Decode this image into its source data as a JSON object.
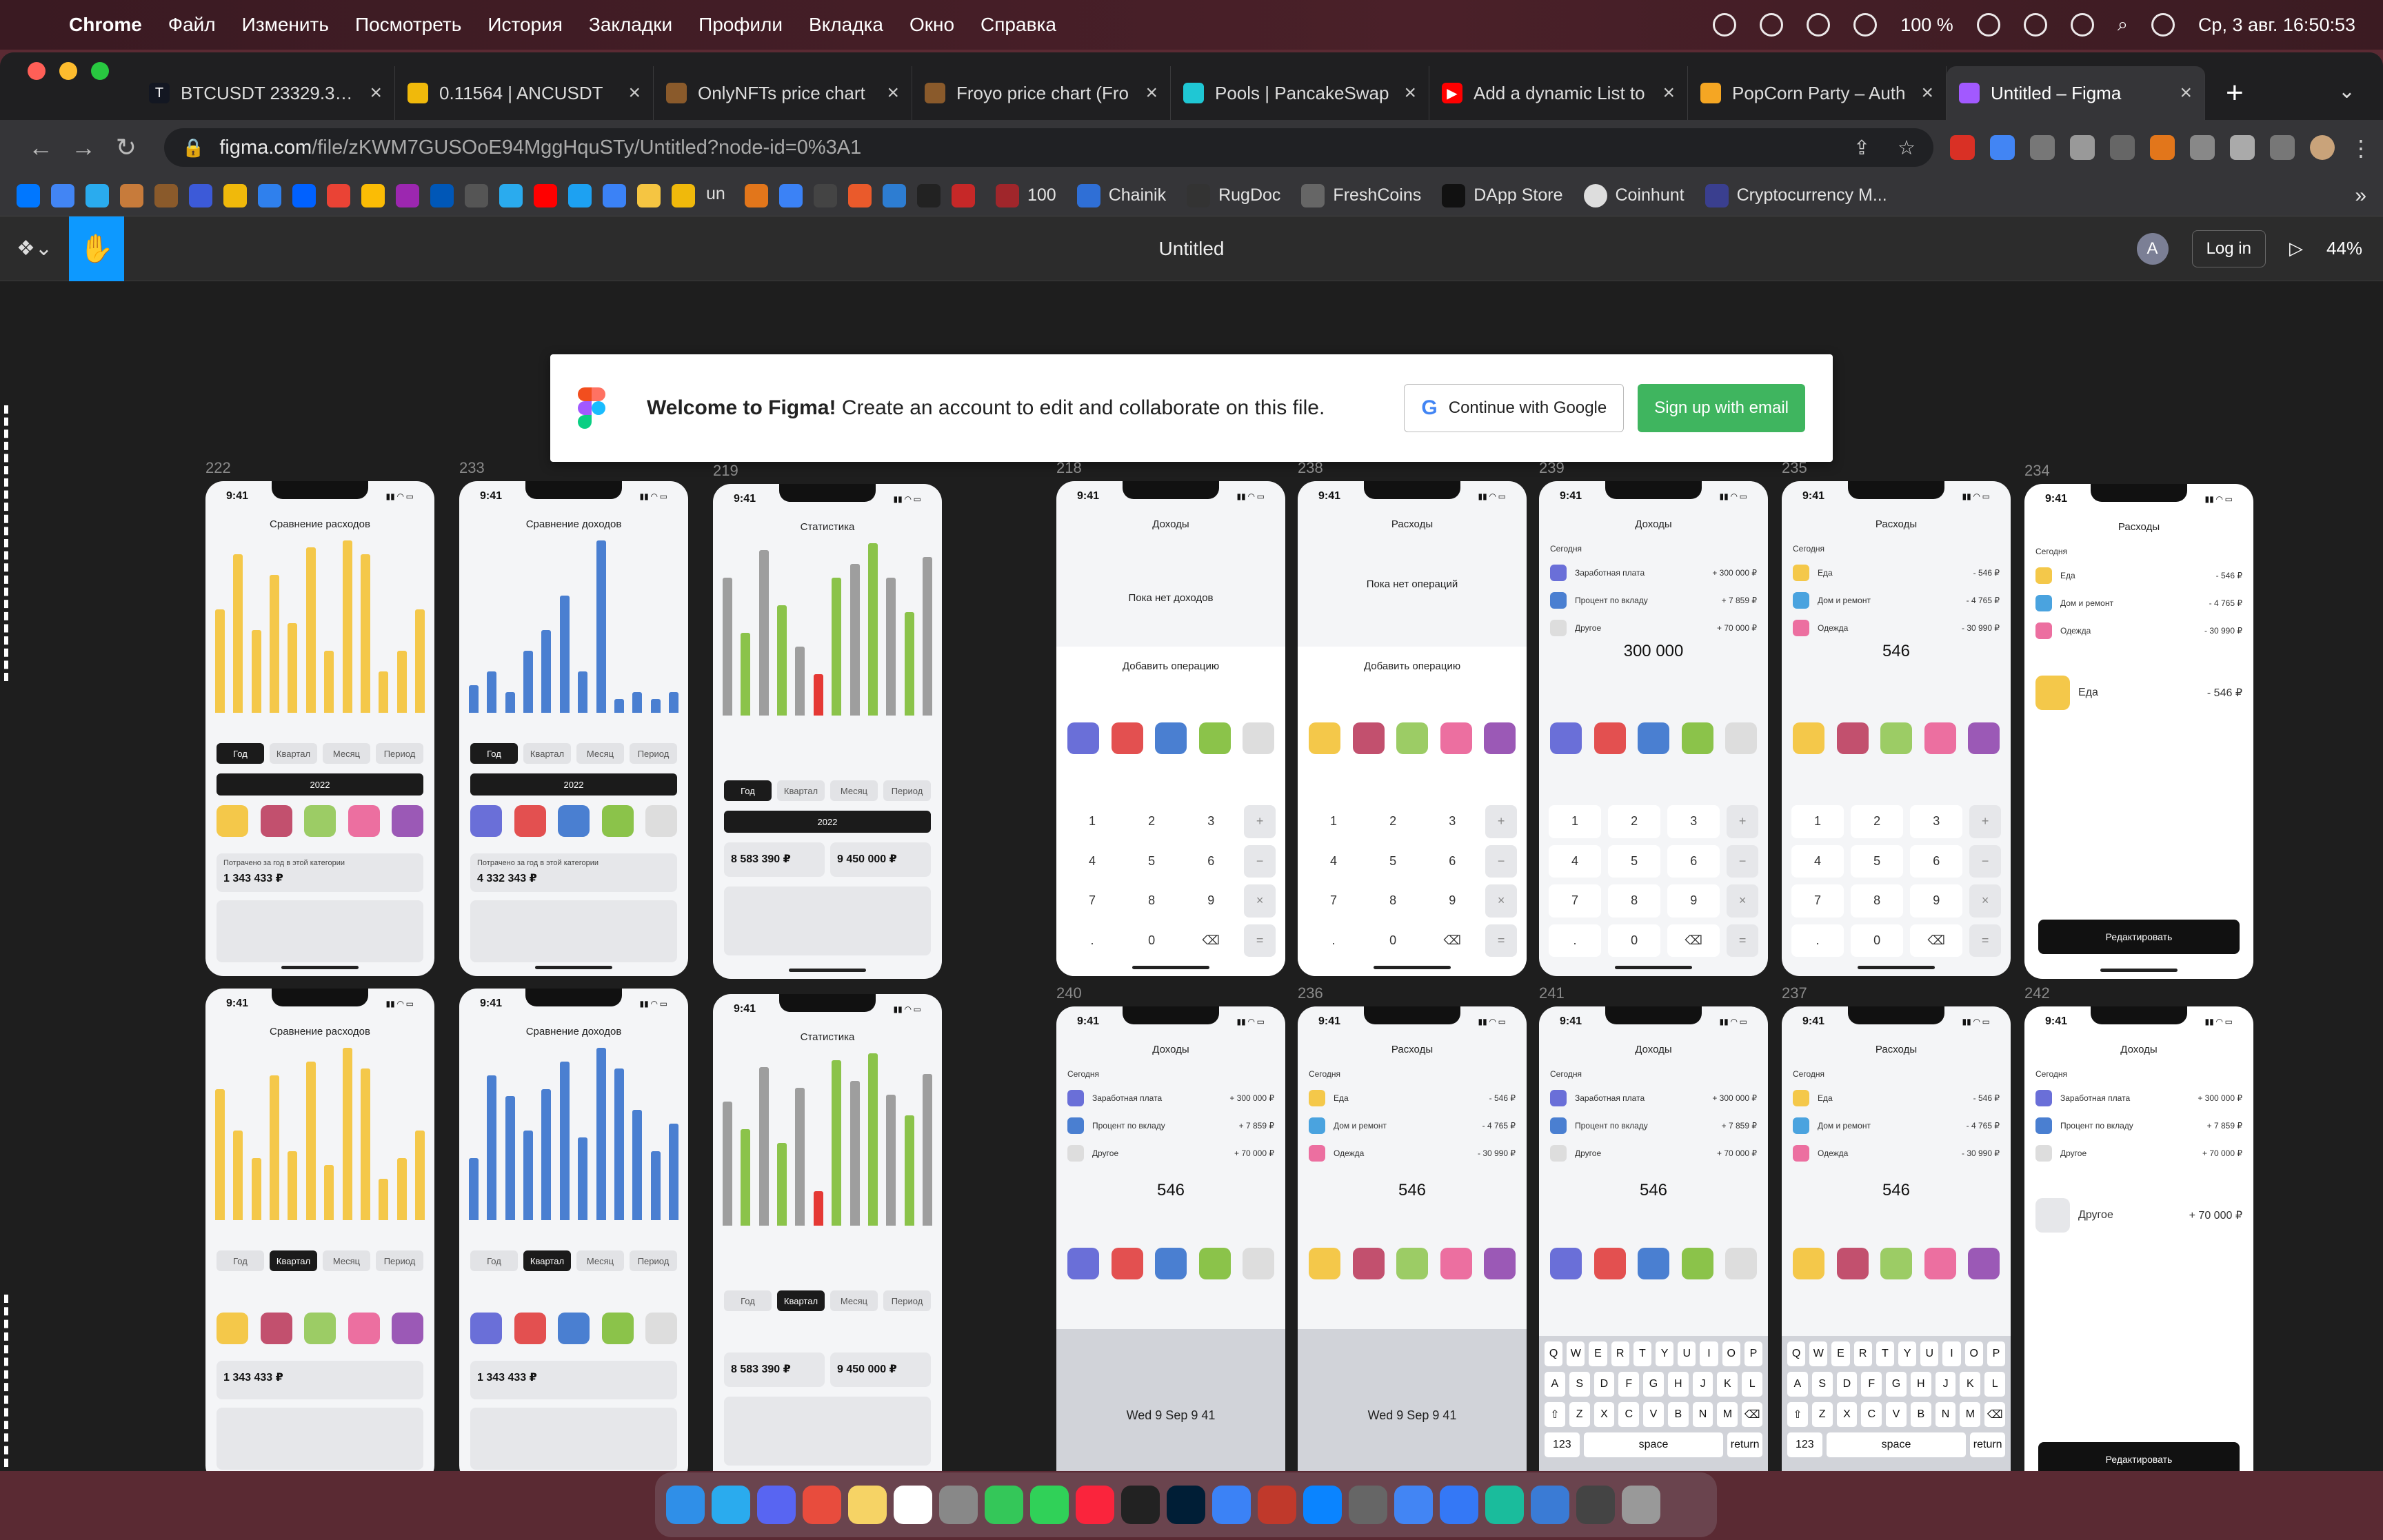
{
  "menubar": {
    "app": "Chrome",
    "items": [
      "Файл",
      "Изменить",
      "Посмотреть",
      "История",
      "Закладки",
      "Профили",
      "Вкладка",
      "Окно",
      "Справка"
    ],
    "battery": "100 %",
    "datetime": "Ср, 3 авг. 16:50:53"
  },
  "tabs": [
    {
      "label": "BTCUSDT 23329.37 ▲",
      "color": "#131722"
    },
    {
      "label": "0.11564 | ANCUSDT",
      "color": "#f0b90b"
    },
    {
      "label": "OnlyNFTs price chart",
      "color": "#8a5a2b"
    },
    {
      "label": "Froyo price chart (Fro",
      "color": "#8a5a2b"
    },
    {
      "label": "Pools | PancakeSwap",
      "color": "#1fc7d4"
    },
    {
      "label": "Add a dynamic List to",
      "color": "#ff0000"
    },
    {
      "label": "PopCorn Party – Auth",
      "color": "#f5a623"
    },
    {
      "label": "Untitled – Figma",
      "color": "#a259ff"
    }
  ],
  "address": {
    "host": "figma.com",
    "path": "/file/zKWM7GUSOoE94MggHquSTy/Untitled?node-id=0%3A1"
  },
  "bookmarks": [
    {
      "label": "100"
    },
    {
      "label": "Chainik"
    },
    {
      "label": "RugDoc"
    },
    {
      "label": "FreshCoins"
    },
    {
      "label": "DApp Store"
    },
    {
      "label": "Coinhunt"
    },
    {
      "label": "Cryptocurrency M..."
    }
  ],
  "figma": {
    "title": "Untitled",
    "avatar": "A",
    "login": "Log in",
    "zoom": "44%"
  },
  "welcome": {
    "bold": "Welcome to Figma!",
    "text": "Create an account to edit and collaborate on this file.",
    "google": "Continue with Google",
    "email": "Sign up with email"
  },
  "frames": {
    "labels": [
      "222",
      "233",
      "219",
      "218",
      "238",
      "239",
      "235",
      "234",
      "240",
      "236",
      "241",
      "237",
      "242"
    ],
    "status_time": "9:41",
    "expense_compare": "Сравнение расходов",
    "income_compare": "Сравнение доходов",
    "stats": "Статистика",
    "income": "Доходы",
    "expense": "Расходы",
    "no_income": "Пока нет доходов",
    "no_ops": "Пока нет операций",
    "add_op": "Добавить операцию",
    "today": "Сегодня",
    "periods": [
      "Год",
      "Квартал",
      "Месяц",
      "Период"
    ],
    "year": "2022",
    "spent_year": "Потрачено за год в этой категории",
    "spent_value": "1 343 433 ₽",
    "earned_value": "4 332 343 ₽",
    "stat_spent": "8 583 390 ₽",
    "stat_earned": "9 450 000 ₽",
    "salary": "Заработная плата",
    "salary_amt": "+ 300 000 ₽",
    "deposit": "Процент по вкладу",
    "deposit_amt": "+ 7 859 ₽",
    "other": "Другое",
    "other_amt": "+ 70 000 ₽",
    "food": "Еда",
    "food_amt": "- 546 ₽",
    "home": "Дом и ремонт",
    "home_amt": "- 4 765 ₽",
    "clothes": "Одежда",
    "clothes_amt": "- 30 990 ₽",
    "sum1": "300 000",
    "sum2": "546",
    "edit": "Редактировать",
    "keys": [
      "1",
      "2",
      "3",
      "+",
      "4",
      "5",
      "6",
      "−",
      "7",
      "8",
      "9",
      "×",
      ".",
      "0",
      "⌫",
      "="
    ],
    "kbd1": [
      "Q",
      "W",
      "E",
      "R",
      "T",
      "Y",
      "U",
      "I",
      "O",
      "P"
    ],
    "kbd2": [
      "A",
      "S",
      "D",
      "F",
      "G",
      "H",
      "J",
      "K",
      "L"
    ],
    "kbd3": [
      "Z",
      "X",
      "C",
      "V",
      "B",
      "N",
      "M"
    ],
    "space": "space",
    "ret": "return",
    "num": "123",
    "picker": "Wed 9 Sep  9  41"
  },
  "colors": {
    "yellow": "#f4c84a",
    "blue": "#4a7fd1",
    "green": "#8bc34a",
    "gray": "#9e9e9e",
    "red": "#e53935"
  }
}
